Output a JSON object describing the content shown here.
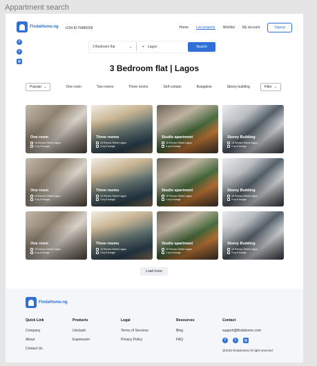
{
  "frame_title": "Appartment search",
  "header": {
    "logo_text": "FindaHome.ng",
    "phone": "+234 8179486009",
    "nav": [
      "Home",
      "List property",
      "Wishlist",
      "My account"
    ],
    "signup_label": "Signup"
  },
  "search": {
    "type_value": "3 Bedroom flat",
    "location_value": "Lagos",
    "button_label": "Search"
  },
  "page_title": "3 Bedroom flat  | Lagos",
  "filters": {
    "sort_label": "Popular",
    "options": [
      "One room",
      "Two rooms",
      "Three rooms",
      "Self contain",
      "Bungalow",
      "Storey building"
    ],
    "filter_label": "Filter"
  },
  "listings": [
    {
      "name": "One room",
      "address": "15 Remco Street Lagos",
      "detail": "3 sq ft lounge"
    },
    {
      "name": "Three rooms",
      "address": "15 Remco Street Lagos",
      "detail": "3 sq ft lounge"
    },
    {
      "name": "Studio apartment",
      "address": "15 Remco Street Lagos",
      "detail": "3 sq ft lounge"
    },
    {
      "name": "Storey Building",
      "address": "15 Remco Street Lagos",
      "detail": "3 sq ft lounge"
    }
  ],
  "load_more_label": "Load more",
  "footer": {
    "logo_text": "FindaHome.ng",
    "quick_link": {
      "heading": "Quick Link",
      "items": [
        "Company",
        "About",
        "Contact Us"
      ]
    },
    "products": {
      "heading": "Products",
      "items": [
        "Uniclash",
        "Espressom"
      ]
    },
    "legal": {
      "heading": "Legal",
      "items": [
        "Terms of Services",
        "Privacy Policy"
      ]
    },
    "resources": {
      "heading": "Resources",
      "items": [
        "Blog",
        "FAQ"
      ]
    },
    "contact": {
      "heading": "Contact",
      "email": "support@findahome.com",
      "copyright": "@2023 findahome| All right reserved"
    }
  },
  "colors": {
    "accent": "#2f6fd6"
  },
  "icons": [
    "facebook-icon",
    "twitter-icon",
    "instagram-icon",
    "chevron-down-icon",
    "location-pin-icon"
  ]
}
